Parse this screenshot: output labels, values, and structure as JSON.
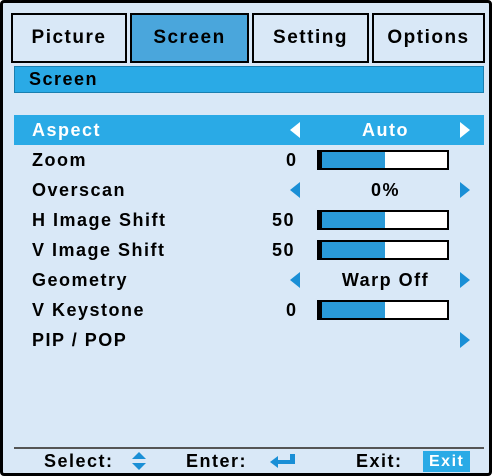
{
  "tabs": [
    {
      "label": "Picture"
    },
    {
      "label": "Screen",
      "active": true
    },
    {
      "label": "Setting"
    },
    {
      "label": "Options"
    }
  ],
  "title": "Screen",
  "menu": {
    "aspect": {
      "label": "Aspect",
      "value": "Auto"
    },
    "zoom": {
      "label": "Zoom",
      "value": "0",
      "level": 0.5
    },
    "overscan": {
      "label": "Overscan",
      "value": "0%"
    },
    "h_image_shift": {
      "label": "H Image Shift",
      "value": "50",
      "level": 0.5
    },
    "v_image_shift": {
      "label": "V Image Shift",
      "value": "50",
      "level": 0.5
    },
    "geometry": {
      "label": "Geometry",
      "value": "Warp Off"
    },
    "v_keystone": {
      "label": "V Keystone",
      "value": "0",
      "level": 0.5
    },
    "pip_pop": {
      "label": "PIP / POP"
    }
  },
  "status": {
    "select": "Select:",
    "enter": "Enter:",
    "exit": "Exit:",
    "exit_badge": "Exit"
  },
  "colors": {
    "background": "#d9e8f7",
    "accent": "#2aaae6",
    "active_tab": "#4aa6dc",
    "bar_fill": "#2a9ad8"
  },
  "icons": {
    "select": "up-down-arrows-icon",
    "enter": "enter-return-icon"
  }
}
